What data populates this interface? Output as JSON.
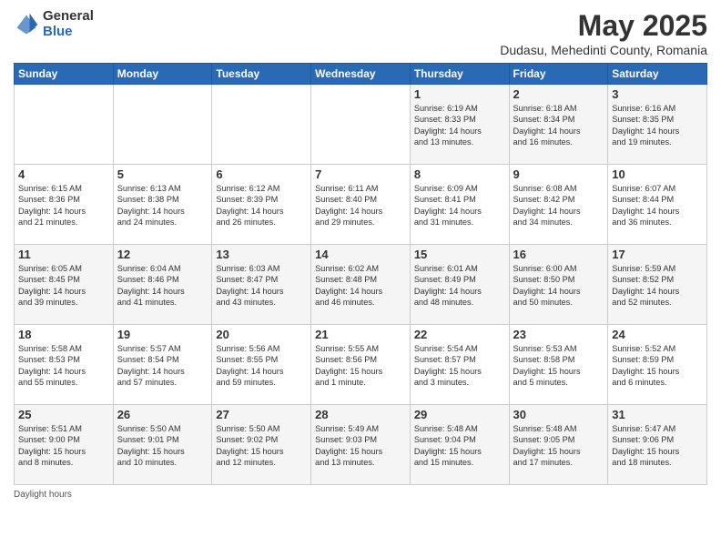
{
  "header": {
    "logo_general": "General",
    "logo_blue": "Blue",
    "month_title": "May 2025",
    "location": "Dudasu, Mehedinti County, Romania"
  },
  "weekdays": [
    "Sunday",
    "Monday",
    "Tuesday",
    "Wednesday",
    "Thursday",
    "Friday",
    "Saturday"
  ],
  "weeks": [
    [
      {
        "day": "",
        "content": ""
      },
      {
        "day": "",
        "content": ""
      },
      {
        "day": "",
        "content": ""
      },
      {
        "day": "",
        "content": ""
      },
      {
        "day": "1",
        "content": "Sunrise: 6:19 AM\nSunset: 8:33 PM\nDaylight: 14 hours\nand 13 minutes."
      },
      {
        "day": "2",
        "content": "Sunrise: 6:18 AM\nSunset: 8:34 PM\nDaylight: 14 hours\nand 16 minutes."
      },
      {
        "day": "3",
        "content": "Sunrise: 6:16 AM\nSunset: 8:35 PM\nDaylight: 14 hours\nand 19 minutes."
      }
    ],
    [
      {
        "day": "4",
        "content": "Sunrise: 6:15 AM\nSunset: 8:36 PM\nDaylight: 14 hours\nand 21 minutes."
      },
      {
        "day": "5",
        "content": "Sunrise: 6:13 AM\nSunset: 8:38 PM\nDaylight: 14 hours\nand 24 minutes."
      },
      {
        "day": "6",
        "content": "Sunrise: 6:12 AM\nSunset: 8:39 PM\nDaylight: 14 hours\nand 26 minutes."
      },
      {
        "day": "7",
        "content": "Sunrise: 6:11 AM\nSunset: 8:40 PM\nDaylight: 14 hours\nand 29 minutes."
      },
      {
        "day": "8",
        "content": "Sunrise: 6:09 AM\nSunset: 8:41 PM\nDaylight: 14 hours\nand 31 minutes."
      },
      {
        "day": "9",
        "content": "Sunrise: 6:08 AM\nSunset: 8:42 PM\nDaylight: 14 hours\nand 34 minutes."
      },
      {
        "day": "10",
        "content": "Sunrise: 6:07 AM\nSunset: 8:44 PM\nDaylight: 14 hours\nand 36 minutes."
      }
    ],
    [
      {
        "day": "11",
        "content": "Sunrise: 6:05 AM\nSunset: 8:45 PM\nDaylight: 14 hours\nand 39 minutes."
      },
      {
        "day": "12",
        "content": "Sunrise: 6:04 AM\nSunset: 8:46 PM\nDaylight: 14 hours\nand 41 minutes."
      },
      {
        "day": "13",
        "content": "Sunrise: 6:03 AM\nSunset: 8:47 PM\nDaylight: 14 hours\nand 43 minutes."
      },
      {
        "day": "14",
        "content": "Sunrise: 6:02 AM\nSunset: 8:48 PM\nDaylight: 14 hours\nand 46 minutes."
      },
      {
        "day": "15",
        "content": "Sunrise: 6:01 AM\nSunset: 8:49 PM\nDaylight: 14 hours\nand 48 minutes."
      },
      {
        "day": "16",
        "content": "Sunrise: 6:00 AM\nSunset: 8:50 PM\nDaylight: 14 hours\nand 50 minutes."
      },
      {
        "day": "17",
        "content": "Sunrise: 5:59 AM\nSunset: 8:52 PM\nDaylight: 14 hours\nand 52 minutes."
      }
    ],
    [
      {
        "day": "18",
        "content": "Sunrise: 5:58 AM\nSunset: 8:53 PM\nDaylight: 14 hours\nand 55 minutes."
      },
      {
        "day": "19",
        "content": "Sunrise: 5:57 AM\nSunset: 8:54 PM\nDaylight: 14 hours\nand 57 minutes."
      },
      {
        "day": "20",
        "content": "Sunrise: 5:56 AM\nSunset: 8:55 PM\nDaylight: 14 hours\nand 59 minutes."
      },
      {
        "day": "21",
        "content": "Sunrise: 5:55 AM\nSunset: 8:56 PM\nDaylight: 15 hours\nand 1 minute."
      },
      {
        "day": "22",
        "content": "Sunrise: 5:54 AM\nSunset: 8:57 PM\nDaylight: 15 hours\nand 3 minutes."
      },
      {
        "day": "23",
        "content": "Sunrise: 5:53 AM\nSunset: 8:58 PM\nDaylight: 15 hours\nand 5 minutes."
      },
      {
        "day": "24",
        "content": "Sunrise: 5:52 AM\nSunset: 8:59 PM\nDaylight: 15 hours\nand 6 minutes."
      }
    ],
    [
      {
        "day": "25",
        "content": "Sunrise: 5:51 AM\nSunset: 9:00 PM\nDaylight: 15 hours\nand 8 minutes."
      },
      {
        "day": "26",
        "content": "Sunrise: 5:50 AM\nSunset: 9:01 PM\nDaylight: 15 hours\nand 10 minutes."
      },
      {
        "day": "27",
        "content": "Sunrise: 5:50 AM\nSunset: 9:02 PM\nDaylight: 15 hours\nand 12 minutes."
      },
      {
        "day": "28",
        "content": "Sunrise: 5:49 AM\nSunset: 9:03 PM\nDaylight: 15 hours\nand 13 minutes."
      },
      {
        "day": "29",
        "content": "Sunrise: 5:48 AM\nSunset: 9:04 PM\nDaylight: 15 hours\nand 15 minutes."
      },
      {
        "day": "30",
        "content": "Sunrise: 5:48 AM\nSunset: 9:05 PM\nDaylight: 15 hours\nand 17 minutes."
      },
      {
        "day": "31",
        "content": "Sunrise: 5:47 AM\nSunset: 9:06 PM\nDaylight: 15 hours\nand 18 minutes."
      }
    ]
  ],
  "footer": {
    "daylight_label": "Daylight hours"
  }
}
